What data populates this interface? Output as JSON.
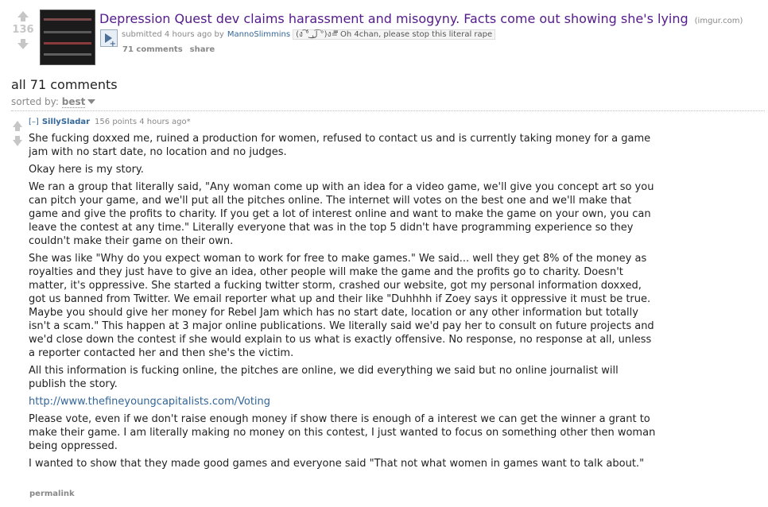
{
  "post": {
    "score": "136",
    "title": "Depression Quest dev claims harassment and misogyny. Facts come out showing she's lying",
    "domain": "(imgur.com)",
    "tagline_prefix": "submitted 4 hours ago by",
    "author": "MannoSlimmins",
    "flair": "(ง ͠° ͟ل͜ ͡°)ง=̿̿̿̿̿̿̿̿ Oh 4chan, please stop this literal rape",
    "comments_label": "71 comments",
    "share_label": "share"
  },
  "comments_header": {
    "title": "all 71 comments",
    "sort_label": "sorted by:",
    "sort_value": "best"
  },
  "comment": {
    "collapse_label": "[–]",
    "author": "SillySladar",
    "meta": "156 points 4 hours ago*",
    "paragraphs": [
      "She fucking doxxed me, ruined a production for women, refused to contact us and is currently taking money for a game jam with no start date, no location and no judges.",
      "Okay here is my story.",
      "We ran a group that literally said, \"Any woman come up with an idea for a video game, we'll give you concept art so you can pitch your game, and we'll put all the pitches online. The internet will votes on the best one and we'll make that game and give the profits to charity. If you get a lot of interest online and want to make the game on your own, you can leave the contest at any time.\" Literally everyone that was in the top 5 didn't have programming experience so they couldn't make their game on their own.",
      "She was like \"Why do you expect woman to work for free to make games.\" We said... well they get 8% of the money as royalties and they just have to give an idea, other people will make the game and the profits go to charity. Doesn't matter, it's oppressive. She started a fucking twitter storm, crashed our website, got my personal information doxxed, got us banned from Twitter. We email reporter what up and their like \"Duhhhh if Zoey says it oppressive it must be true. Maybe you should give her money for Rebel Jam which has no start date, location or any other information but totally isn't a scam.\" This happen at 3 major online publications. We literally said we'd pay her to consult on future projects and we'd close down the contest if she would explain to us what is exactly offensive. No response, no response at all, unless a reporter contacted her and then she's the victim.",
      "All this information is fucking online, the pitches are online, we did everything we said but no online journalist will publish the story."
    ],
    "link": "http://www.thefineyoungcapitalists.com/Voting",
    "paragraphs_after": [
      "Please vote, even if we don't raise enough money if show there is enough of a interest we can get the winner a grant to make their game. I am literally making no money on this contest, I just wanted to focus on something other then woman being oppressed.",
      "I wanted to show that they made good games and everyone said \"That not what women in games want to talk about.\""
    ],
    "permalink_label": "permalink"
  }
}
